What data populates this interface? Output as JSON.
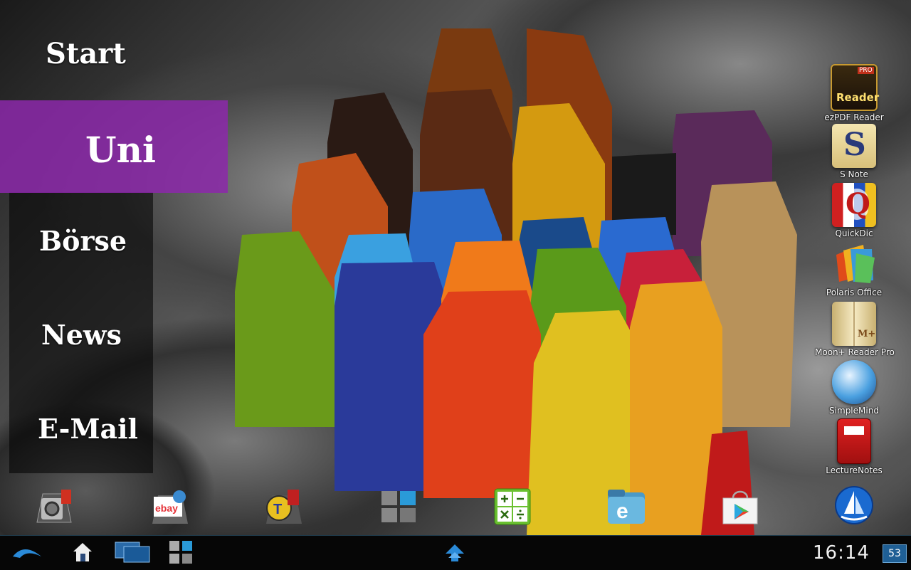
{
  "menu": {
    "items": [
      {
        "label": "Start"
      },
      {
        "label": "Uni"
      },
      {
        "label": "Börse"
      },
      {
        "label": "News"
      },
      {
        "label": "E-Mail"
      }
    ],
    "selected_index": 1,
    "accent": "#8c28aa"
  },
  "apps": [
    {
      "label": "ezPDF Reader",
      "icon": "ezpdf-reader-icon",
      "icon_text": "Reader",
      "icon_badge": "PRO"
    },
    {
      "label": "S Note",
      "icon": "s-note-icon",
      "icon_text": "S"
    },
    {
      "label": "QuickDic",
      "icon": "quickdic-icon",
      "icon_text": "Q"
    },
    {
      "label": "Polaris Office",
      "icon": "polaris-office-icon"
    },
    {
      "label": "Moon+ Reader Pro",
      "icon": "moon-reader-icon",
      "icon_text": "M+"
    },
    {
      "label": "SimpleMind",
      "icon": "simplemind-icon"
    },
    {
      "label": "LectureNotes",
      "icon": "lecturenotes-icon"
    }
  ],
  "dock": [
    {
      "name": "settings-app-icon"
    },
    {
      "name": "ebay-app-icon",
      "text": "ebay"
    },
    {
      "name": "titanium-app-icon",
      "text": "T"
    },
    {
      "name": "widget-app-icon"
    },
    {
      "name": "calculator-app-icon"
    },
    {
      "name": "file-manager-app-icon",
      "text": "e"
    },
    {
      "name": "play-store-app-icon"
    },
    {
      "name": "boat-browser-app-icon"
    }
  ],
  "status": {
    "time": "16:14",
    "battery": "53"
  }
}
